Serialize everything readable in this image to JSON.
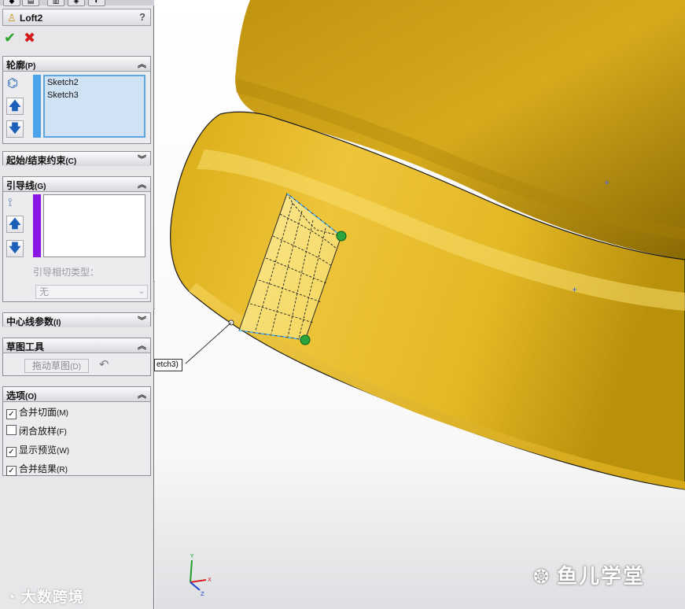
{
  "panel": {
    "title": "Loft2",
    "help": "?",
    "ok_symbol": "✔",
    "cancel_symbol": "✖",
    "profiles": {
      "header": "轮廓",
      "shortcut": "(P)",
      "items": [
        "Sketch2",
        "Sketch3"
      ],
      "bar_color": "#4aa3e8"
    },
    "start_end": {
      "header": "起始/结束约束",
      "shortcut": "(C)"
    },
    "guides": {
      "header": "引导线",
      "shortcut": "(G)",
      "tangency_label": "引导相切类型：",
      "tangency_value": "无",
      "bar_color": "#8a16e6"
    },
    "centerline": {
      "header": "中心线参数",
      "shortcut": "(I)"
    },
    "sketch_tools": {
      "header": "草图工具",
      "drag_label": "拖动草图",
      "drag_shortcut": "(D)"
    },
    "options": {
      "header": "选项",
      "shortcut": "(O)",
      "items": [
        {
          "label": "合并切面",
          "shortcut": "(M)",
          "checked": true
        },
        {
          "label": "闭合放样",
          "shortcut": "(F)",
          "checked": false
        },
        {
          "label": "显示预览",
          "shortcut": "(W)",
          "checked": true
        },
        {
          "label": "合并结果",
          "shortcut": "(R)",
          "checked": true
        }
      ]
    }
  },
  "viewport": {
    "callout": "etch3)",
    "triad": {
      "x": "X",
      "y": "Y",
      "z": "Z"
    },
    "body_color": "#e2b92a"
  },
  "watermarks": {
    "left": "大数跨境",
    "right": "鱼儿学堂"
  }
}
